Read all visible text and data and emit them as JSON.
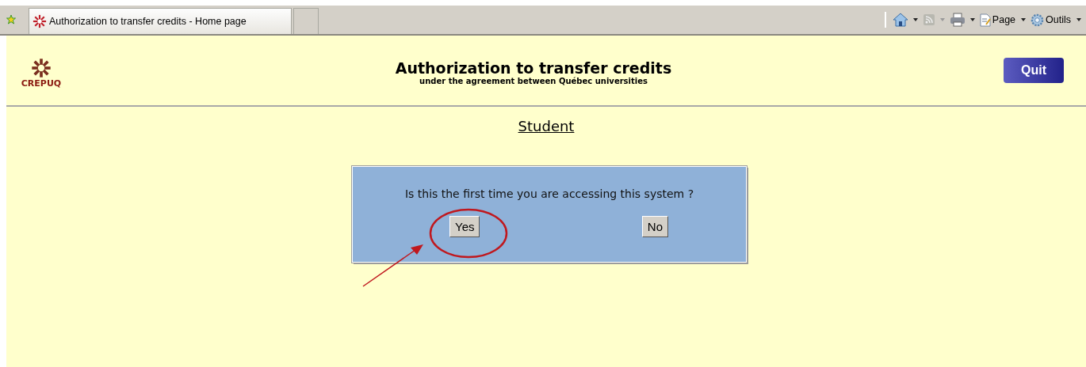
{
  "browser": {
    "tab_title": "Authorization to transfer credits - Home page",
    "commands": [
      {
        "label": "Page"
      },
      {
        "label": "Outils"
      }
    ]
  },
  "header": {
    "logo_text": "CREPUQ",
    "title": "Authorization to transfer credits",
    "subtitle": "under the agreement between Québec universities",
    "quit_button": "Quit"
  },
  "section_link": "Student",
  "dialog": {
    "question": "Is this the first time you are accessing this system ?",
    "buttons": [
      "Yes",
      "No"
    ]
  }
}
